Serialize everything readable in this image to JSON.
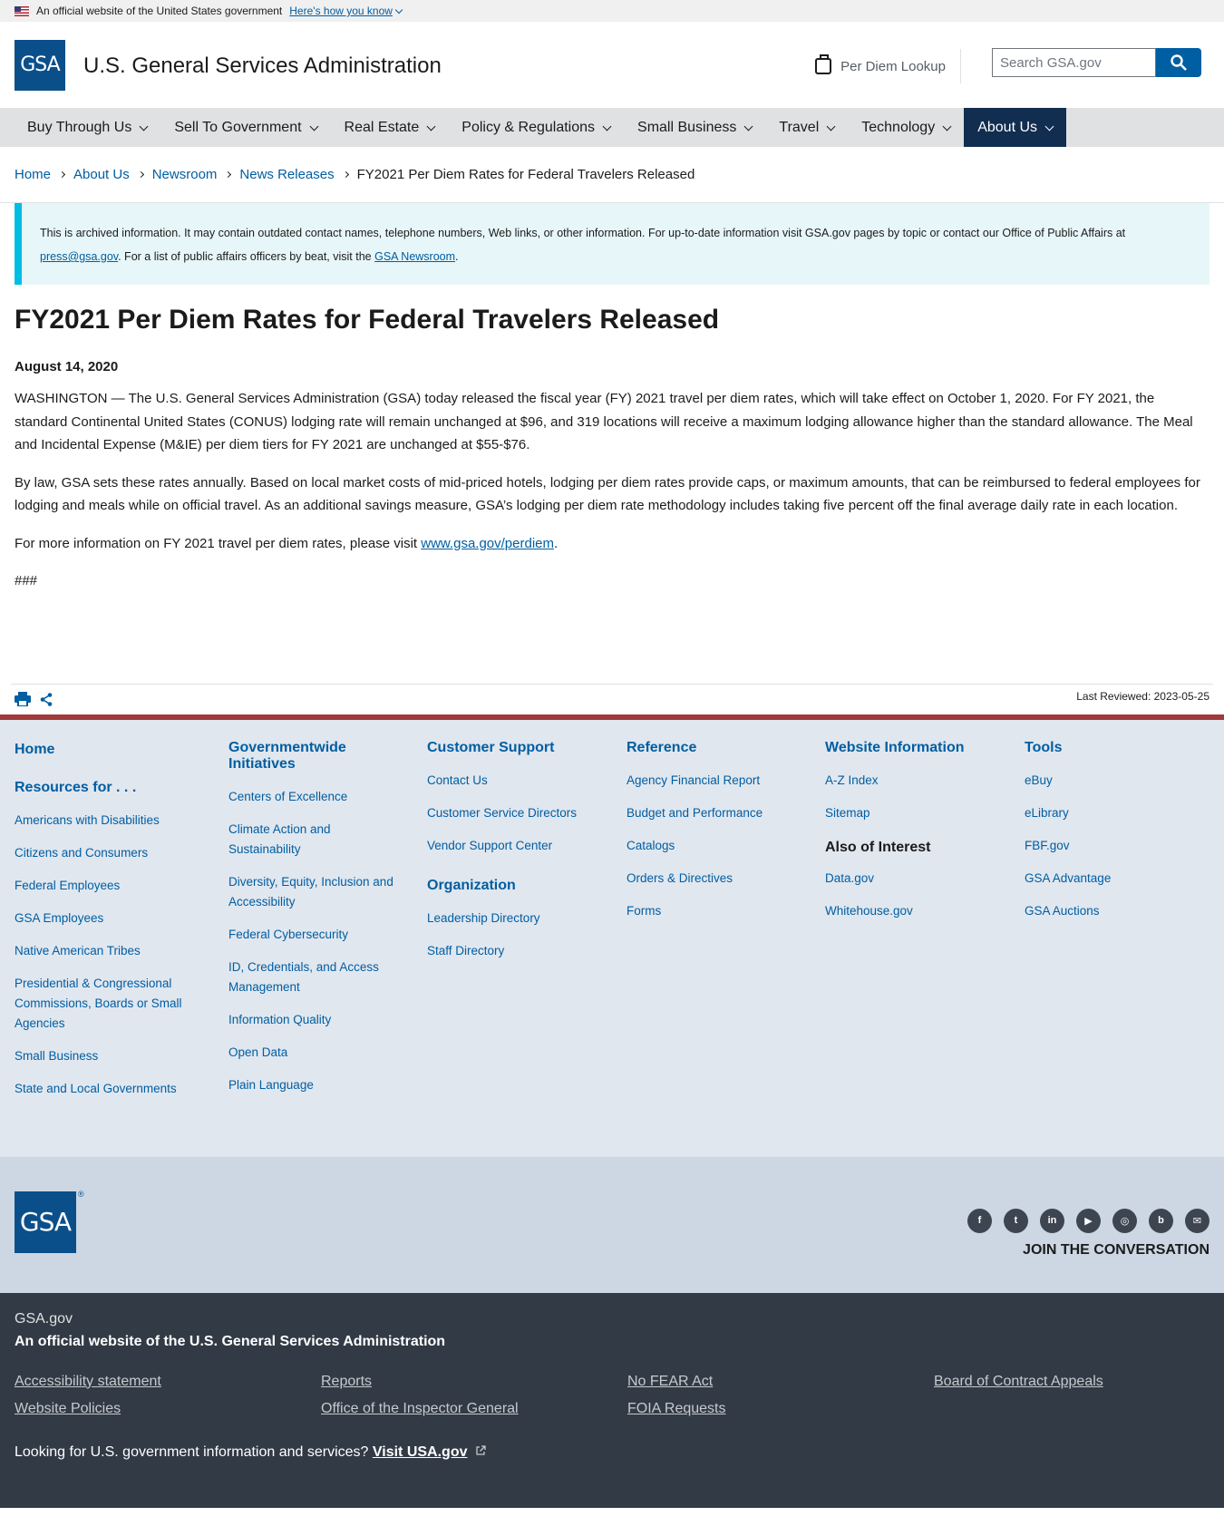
{
  "gov_banner": {
    "text": "An official website of the United States government",
    "how_link": "Here's how you know"
  },
  "header": {
    "logo_text": "GSA",
    "site_title": "U.S. General Services Administration",
    "per_diem_label": "Per Diem Lookup",
    "search_placeholder": "Search GSA.gov"
  },
  "nav": {
    "items": [
      {
        "label": "Buy Through Us"
      },
      {
        "label": "Sell To Government"
      },
      {
        "label": "Real Estate"
      },
      {
        "label": "Policy & Regulations"
      },
      {
        "label": "Small Business"
      },
      {
        "label": "Travel"
      },
      {
        "label": "Technology"
      },
      {
        "label": "About Us"
      }
    ]
  },
  "breadcrumb": {
    "items": [
      "Home",
      "About Us",
      "Newsroom",
      "News Releases"
    ],
    "current": "FY2021 Per Diem Rates for Federal Travelers Released"
  },
  "alert": {
    "text_1": "This is archived information. It may contain outdated contact names, telephone numbers, Web links, or other information. For up-to-date information visit GSA.gov pages by topic or contact our Office of Public Affairs at ",
    "email": "press@gsa.gov",
    "text_2": ". For a list of public affairs officers by beat, visit the ",
    "newsroom_link": "GSA Newsroom",
    "text_3": "."
  },
  "article": {
    "title": "FY2021 Per Diem Rates for Federal Travelers Released",
    "date": "August 14, 2020",
    "p1": "WASHINGTON — The U.S. General Services Administration (GSA) today released the fiscal year (FY) 2021 travel per diem rates, which will take effect on October 1, 2020. For FY 2021, the standard Continental United States (CONUS) lodging rate will remain unchanged at $96, and 319 locations will receive a maximum lodging allowance higher than the standard allowance. The Meal and Incidental Expense (M&IE) per diem tiers for FY 2021 are unchanged at $55-$76.",
    "p2": "By law, GSA sets these rates annually. Based on local market costs of mid-priced hotels, lodging per diem rates provide caps, or maximum amounts, that can be reimbursed to federal employees for lodging and meals while on official travel. As an additional savings measure, GSA’s lodging per diem rate methodology includes taking five percent off the final average daily rate in each location.",
    "p3_prefix": "For more information on FY 2021 travel per diem rates, please visit ",
    "p3_link": "www.gsa.gov/perdiem",
    "p3_suffix": ".",
    "end_mark": "###",
    "last_reviewed": "Last Reviewed: 2023-05-25"
  },
  "footer": {
    "col1": {
      "home": "Home",
      "heading": "Resources for . . .",
      "links": [
        "Americans with Disabilities",
        "Citizens and Consumers",
        "Federal Employees",
        "GSA Employees",
        "Native American Tribes",
        "Presidential & Congressional Commissions, Boards or Small Agencies",
        "Small Business",
        "State and Local Governments"
      ]
    },
    "col2": {
      "heading": "Governmentwide Initiatives",
      "links": [
        "Centers of Excellence",
        "Climate Action and Sustainability",
        "Diversity, Equity, Inclusion and Accessibility",
        "Federal Cybersecurity",
        "ID, Credentials, and Access Management",
        "Information Quality",
        "Open Data",
        "Plain Language"
      ]
    },
    "col3": {
      "heading": "Customer Support",
      "links": [
        "Contact Us",
        "Customer Service Directors",
        "Vendor Support Center"
      ],
      "heading2": "Organization",
      "links2": [
        "Leadership Directory",
        "Staff Directory"
      ]
    },
    "col4": {
      "heading": "Reference",
      "links": [
        "Agency Financial Report",
        "Budget and Performance",
        "Catalogs",
        "Orders & Directives",
        "Forms"
      ]
    },
    "col5": {
      "heading": "Website Information",
      "links": [
        "A-Z Index",
        "Sitemap"
      ],
      "heading2": "Also of Interest",
      "links2": [
        "Data.gov",
        "Whitehouse.gov"
      ]
    },
    "col6": {
      "heading": "Tools",
      "links": [
        "eBuy",
        "eLibrary",
        "FBF.gov",
        "GSA Advantage",
        "GSA Auctions"
      ]
    },
    "logo_text": "GSA",
    "social_icons": [
      "facebook-icon",
      "twitter-icon",
      "linkedin-icon",
      "youtube-icon",
      "instagram-icon",
      "blog-icon",
      "email-icon"
    ],
    "join": "JOIN THE CONVERSATION",
    "site": "GSA.gov",
    "official": "An official website of the U.S. General Services Administration",
    "bottom_links": [
      "Accessibility statement",
      "Reports",
      "No FEAR Act",
      "Board of Contract Appeals",
      "Website Policies",
      "Office of the Inspector General",
      "FOIA Requests"
    ],
    "usa_prefix": "Looking for U.S. government information and services? ",
    "usa_link": "Visit USA.gov"
  },
  "colors": {
    "primary": "#005ea2",
    "nav_active": "#112e51",
    "footer_dark": "#323a45",
    "accent_red": "#a03a3a",
    "alert_border": "#00bde3"
  }
}
